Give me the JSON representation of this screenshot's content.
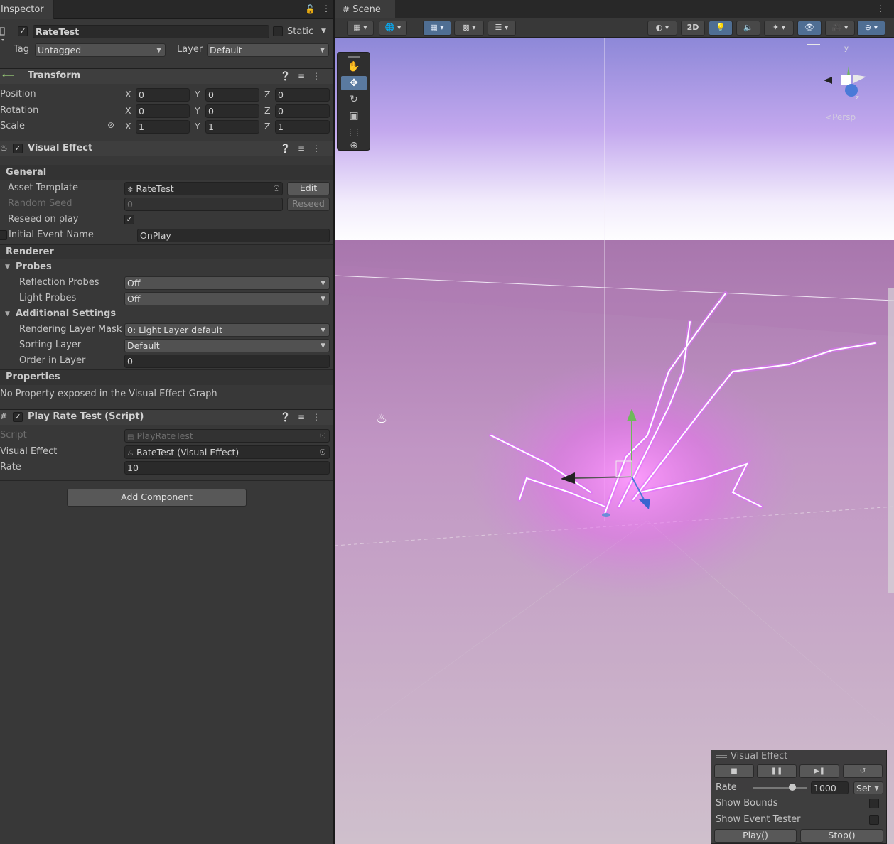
{
  "inspector": {
    "tab_label": "Inspector",
    "object": {
      "name": "RateTest",
      "static_label": "Static",
      "tag_label": "Tag",
      "tag_value": "Untagged",
      "layer_label": "Layer",
      "layer_value": "Default"
    },
    "transform": {
      "title": "Transform",
      "position_label": "Position",
      "rotation_label": "Rotation",
      "scale_label": "Scale",
      "x_label": "X",
      "y_label": "Y",
      "z_label": "Z",
      "position": [
        "0",
        "0",
        "0"
      ],
      "rotation": [
        "0",
        "0",
        "0"
      ],
      "scale": [
        "1",
        "1",
        "1"
      ]
    },
    "visual_effect": {
      "title": "Visual Effect",
      "general_label": "General",
      "asset_template_label": "Asset Template",
      "asset_template_value": "RateTest",
      "edit_button": "Edit",
      "random_seed_label": "Random Seed",
      "random_seed_value": "0",
      "reseed_button": "Reseed",
      "reseed_on_play_label": "Reseed on play",
      "initial_event_label": "Initial Event Name",
      "initial_event_value": "OnPlay",
      "renderer_label": "Renderer",
      "probes_label": "Probes",
      "reflection_probes_label": "Reflection Probes",
      "reflection_probes_value": "Off",
      "light_probes_label": "Light Probes",
      "light_probes_value": "Off",
      "additional_settings_label": "Additional Settings",
      "rendering_layer_mask_label": "Rendering Layer Mask",
      "rendering_layer_mask_value": "0: Light Layer default",
      "sorting_layer_label": "Sorting Layer",
      "sorting_layer_value": "Default",
      "order_in_layer_label": "Order in Layer",
      "order_in_layer_value": "0",
      "properties_label": "Properties",
      "no_property_text": "No Property exposed in the Visual Effect Graph"
    },
    "play_rate_test": {
      "title": "Play Rate Test (Script)",
      "script_label": "Script",
      "script_value": "PlayRateTest",
      "visual_effect_label": "Visual Effect",
      "visual_effect_value": "RateTest (Visual Effect)",
      "rate_label": "Rate",
      "rate_value": "10"
    },
    "add_component_button": "Add Component"
  },
  "scene": {
    "tab_label": "Scene",
    "toolbar": {
      "two_d_label": "2D"
    },
    "gizmo": {
      "persp_label": "Persp",
      "y_label": "y",
      "z_label": "z"
    },
    "vfx_panel": {
      "title": "Visual Effect",
      "rate_label": "Rate",
      "rate_value": "1000",
      "set_label": "Set",
      "show_bounds_label": "Show Bounds",
      "show_event_tester_label": "Show Event Tester",
      "play_button": "Play()",
      "stop_button": "Stop()"
    }
  },
  "colors": {
    "panel_bg": "#383838",
    "header_bg": "#3e3e3e",
    "field_bg": "#2a2a2a",
    "active_tool": "#5a7aa0",
    "sky": "#b99ce8",
    "ground": "#c9a9c9",
    "lightning": "#e070ff"
  }
}
